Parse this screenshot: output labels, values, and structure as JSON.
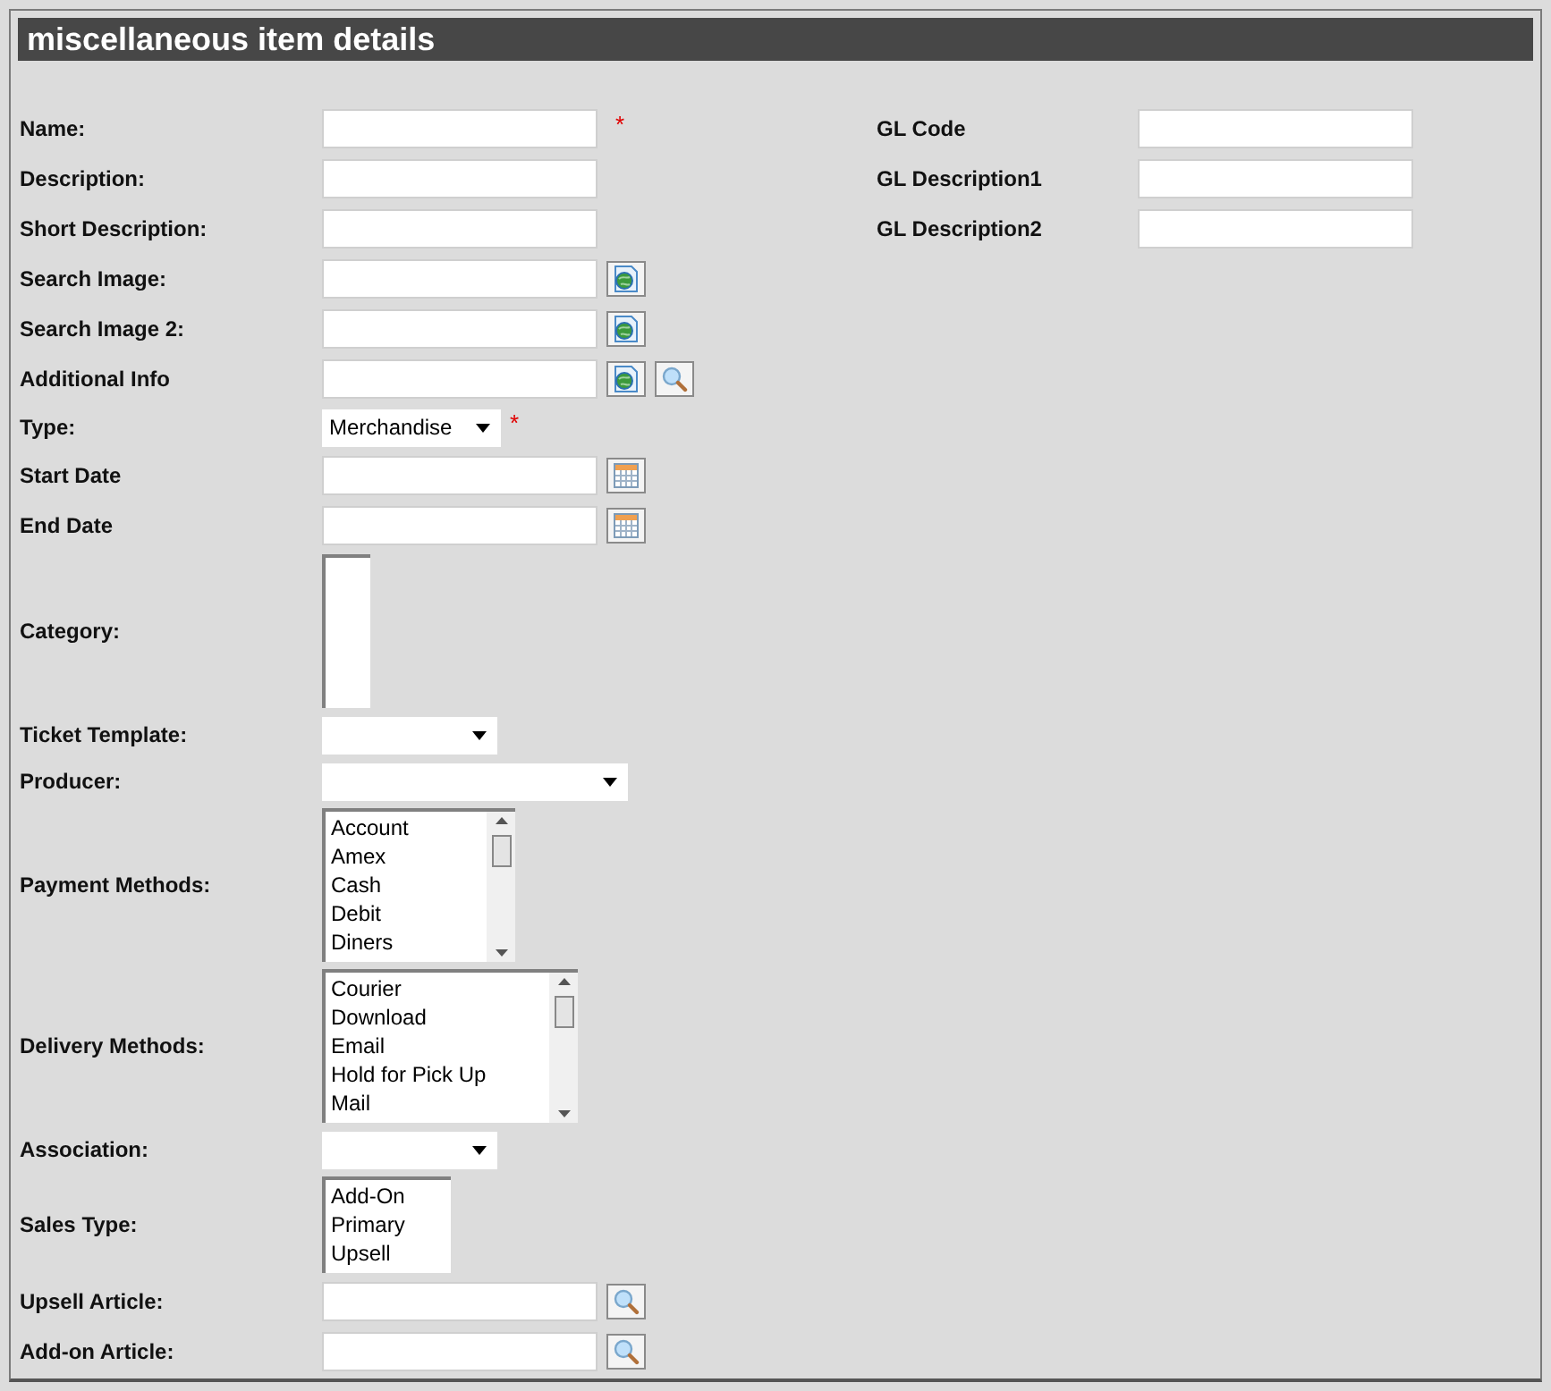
{
  "title": "miscellaneous item details",
  "fields": [
    {
      "label": "Name:",
      "kind": "text",
      "required_mark": "*"
    },
    {
      "label": "Description:",
      "kind": "text"
    },
    {
      "label": "Short Description:",
      "kind": "text"
    },
    {
      "label": "Search Image:",
      "kind": "text",
      "buttons": [
        {
          "kind": "image"
        }
      ]
    },
    {
      "label": "Search Image 2:",
      "kind": "text",
      "buttons": [
        {
          "kind": "image"
        }
      ]
    },
    {
      "label": "Additional Info",
      "kind": "text",
      "buttons": [
        {
          "kind": "image"
        },
        {
          "kind": "search"
        }
      ]
    },
    {
      "label": "Type:",
      "kind": "select",
      "value": "Merchandise",
      "required_mark": "*"
    },
    {
      "label": "Start Date",
      "kind": "text",
      "buttons": [
        {
          "kind": "calendar"
        }
      ]
    },
    {
      "label": "End Date",
      "kind": "text",
      "buttons": [
        {
          "kind": "calendar"
        }
      ]
    },
    {
      "label": "Category:",
      "kind": "listbox"
    },
    {
      "label": "Ticket Template:",
      "kind": "select"
    },
    {
      "label": "Producer:",
      "kind": "select"
    },
    {
      "label": "Payment Methods:",
      "kind": "listbox",
      "options": [
        "Account",
        "Amex",
        "Cash",
        "Debit",
        "Diners"
      ]
    },
    {
      "label": "Delivery Methods:",
      "kind": "listbox",
      "options": [
        "Courier",
        "Download",
        "Email",
        "Hold for Pick Up",
        "Mail"
      ]
    },
    {
      "label": "Association:",
      "kind": "select"
    },
    {
      "label": "Sales Type:",
      "kind": "listbox",
      "options": [
        "Add-On",
        "Primary",
        "Upsell"
      ]
    },
    {
      "label": "Upsell Article:",
      "kind": "text",
      "buttons": [
        {
          "kind": "search"
        }
      ]
    },
    {
      "label": "Add-on Article:",
      "kind": "text",
      "buttons": [
        {
          "kind": "search"
        }
      ]
    }
  ],
  "gl_fields": [
    {
      "label": "GL Code"
    },
    {
      "label": "GL Description1"
    },
    {
      "label": "GL Description2"
    }
  ]
}
